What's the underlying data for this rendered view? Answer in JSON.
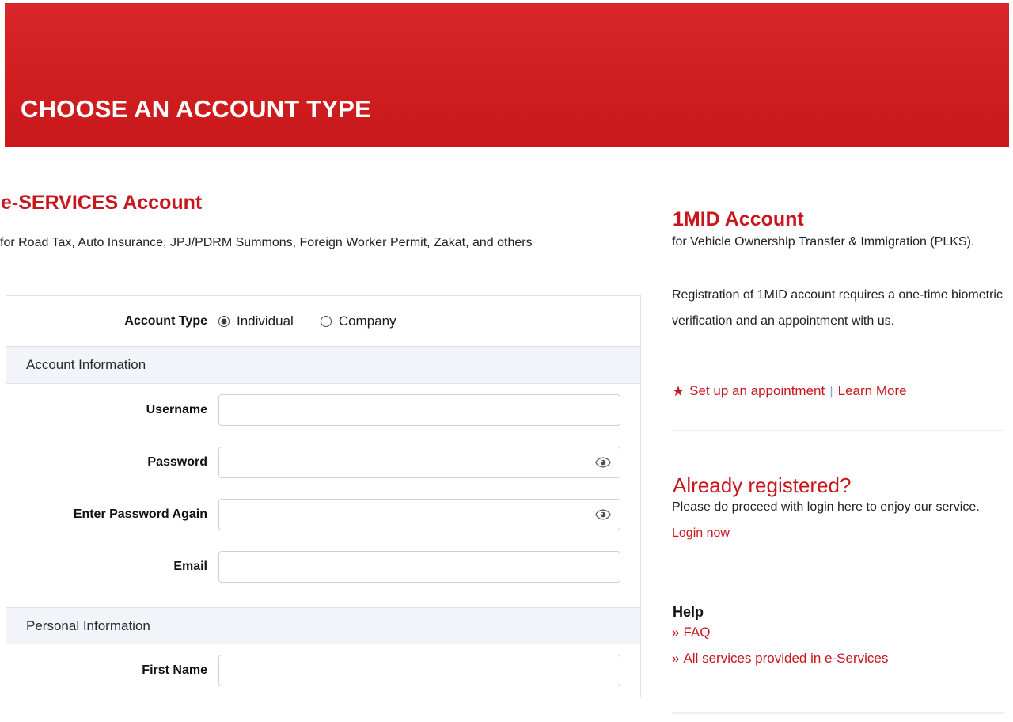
{
  "banner": {
    "title": "CHOOSE AN ACCOUNT TYPE",
    "color": "#d01d20"
  },
  "accent_color": "#c8161d",
  "left": {
    "title": "e-SERVICES Account",
    "description": "for Road Tax, Auto Insurance, JPJ/PDRM Summons, Foreign Worker Permit, Zakat, and others",
    "account_type": {
      "label": "Account Type",
      "options": [
        {
          "label": "Individual",
          "selected": true
        },
        {
          "label": "Company",
          "selected": false
        }
      ]
    },
    "sections": [
      {
        "heading": "Account Information",
        "fields": [
          {
            "label": "Username",
            "value": "",
            "placeholder": "",
            "type": "text",
            "has_eye": false
          },
          {
            "label": "Password",
            "value": "",
            "placeholder": "",
            "type": "password",
            "has_eye": true
          },
          {
            "label": "Enter Password Again",
            "value": "",
            "placeholder": "",
            "type": "password",
            "has_eye": true
          },
          {
            "label": "Email",
            "value": "",
            "placeholder": "",
            "type": "text",
            "has_eye": false
          }
        ]
      },
      {
        "heading": "Personal Information",
        "fields": [
          {
            "label": "First Name",
            "value": "",
            "placeholder": "",
            "type": "text",
            "has_eye": false
          }
        ]
      }
    ]
  },
  "right": {
    "mid": {
      "title": "1MID Account",
      "paragraph_1": "for Vehicle Ownership Transfer & Immigration (PLKS).",
      "paragraph_2": "Registration of 1MID account requires a one-time biometric verification and an appointment with us.",
      "star_icon": "star-icon",
      "appointment_link": "Set up an appointment",
      "separator": "|",
      "learn_more_link": "Learn More"
    },
    "already": {
      "title": "Already registered?",
      "text": "Please do proceed with login here to enjoy our service.",
      "login_link": "Login now"
    },
    "help": {
      "title": "Help",
      "chevron_icon": "»",
      "items": [
        {
          "label": "FAQ"
        },
        {
          "label": "All services provided in e-Services"
        }
      ]
    }
  }
}
